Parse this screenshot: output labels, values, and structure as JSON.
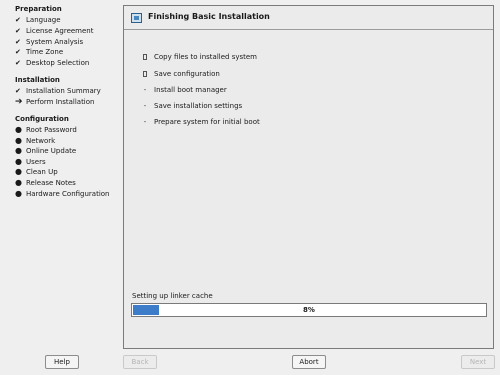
{
  "sidebar": {
    "sections": [
      {
        "title": "Preparation",
        "steps": [
          {
            "label": "Language",
            "state": "done"
          },
          {
            "label": "License Agreement",
            "state": "done"
          },
          {
            "label": "System Analysis",
            "state": "done"
          },
          {
            "label": "Time Zone",
            "state": "done"
          },
          {
            "label": "Desktop Selection",
            "state": "done"
          }
        ]
      },
      {
        "title": "Installation",
        "steps": [
          {
            "label": "Installation Summary",
            "state": "done"
          },
          {
            "label": "Perform Installation",
            "state": "current"
          }
        ]
      },
      {
        "title": "Configuration",
        "steps": [
          {
            "label": "Root Password",
            "state": "pending"
          },
          {
            "label": "Network",
            "state": "pending"
          },
          {
            "label": "Online Update",
            "state": "pending"
          },
          {
            "label": "Users",
            "state": "pending"
          },
          {
            "label": "Clean Up",
            "state": "pending"
          },
          {
            "label": "Release Notes",
            "state": "pending"
          },
          {
            "label": "Hardware Configuration",
            "state": "pending"
          }
        ]
      }
    ],
    "marks": {
      "done": "✔",
      "current": "➔",
      "pending": "●"
    }
  },
  "main": {
    "icon": "installer-icon",
    "title": "Finishing Basic Installation",
    "tasks": [
      {
        "label": "Copy files to installed system",
        "state": "running"
      },
      {
        "label": "Save configuration",
        "state": "running"
      },
      {
        "label": "Install boot manager",
        "state": "todo"
      },
      {
        "label": "Save installation settings",
        "state": "todo"
      },
      {
        "label": "Prepare system for initial boot",
        "state": "todo"
      }
    ],
    "todo_mark": "-",
    "progress": {
      "label": "Setting up linker cache",
      "percent": 8,
      "text": "8%"
    }
  },
  "buttons": {
    "help": "Help",
    "back": "Back",
    "abort": "Abort",
    "next": "Next"
  },
  "colors": {
    "progress_fill": "#3d7cc9",
    "accent": "#2d5f8a"
  }
}
